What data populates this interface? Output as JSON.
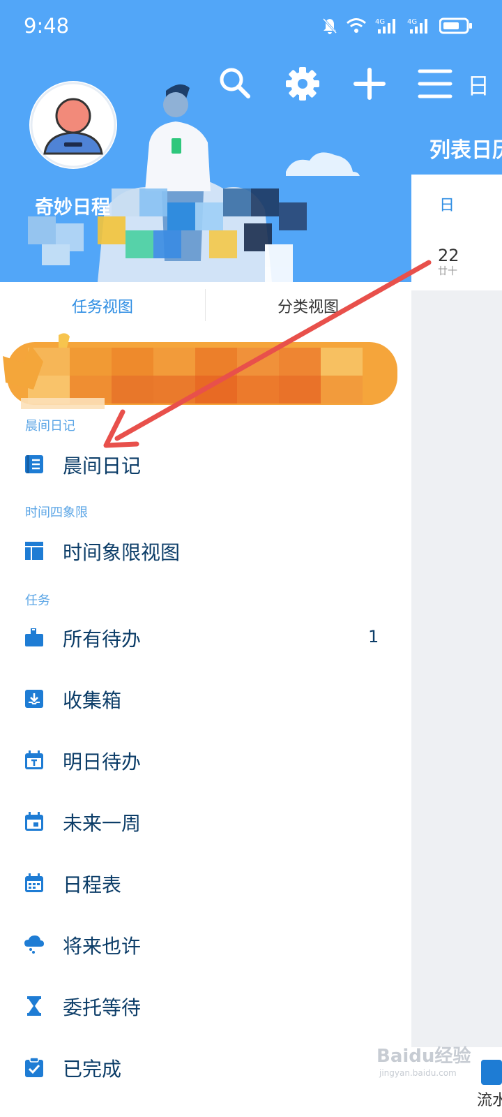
{
  "status_bar": {
    "time": "9:48",
    "icons": [
      "bell-off-icon",
      "wifi-icon",
      "signal-4g-icon",
      "signal-4g-icon",
      "battery-icon"
    ]
  },
  "header": {
    "user_name": "奇妙日程",
    "calendar_title": "列表日历",
    "toolbar_icons": [
      "search-icon",
      "gear-icon",
      "plus-icon",
      "menu-icon"
    ],
    "view_mode_label": "日"
  },
  "tabs": [
    {
      "label": "任务视图"
    },
    {
      "label": "分类视图"
    }
  ],
  "sections": {
    "morning_journal": "晨间日记",
    "time_quadrant": "时间四象限",
    "tasks": "任务"
  },
  "menu": {
    "morning_journal": {
      "label": "晨间日记",
      "icon": "journal-icon"
    },
    "quadrant_view": {
      "label": "时间象限视图",
      "icon": "quadrant-icon"
    },
    "all_todos": {
      "label": "所有待办",
      "icon": "todo-stack-icon",
      "count": "1"
    },
    "inbox": {
      "label": "收集箱",
      "icon": "inbox-icon"
    },
    "tomorrow": {
      "label": "明日待办",
      "icon": "calendar-t-icon"
    },
    "next_week": {
      "label": "未来一周",
      "icon": "calendar-week-icon"
    },
    "schedule": {
      "label": "日程表",
      "icon": "schedule-icon"
    },
    "someday": {
      "label": "将来也许",
      "icon": "cloud-icon"
    },
    "delegated": {
      "label": "委托等待",
      "icon": "hourglass-icon"
    },
    "completed": {
      "label": "已完成",
      "icon": "clipboard-check-icon"
    }
  },
  "calendar": {
    "weekday": "日",
    "date": "22",
    "lunar": "廿十"
  },
  "bottom_nav": {
    "flow_label": "流水"
  },
  "watermark": {
    "text": "Baidu经验",
    "sub": "jingyan.baidu.com"
  },
  "colors": {
    "header_bg": "#52a6f8",
    "accent": "#2f8ee3",
    "menu_text": "#0c3d68",
    "menu_icon": "#1e7cd4",
    "annotation_arrow": "#e8504b"
  }
}
